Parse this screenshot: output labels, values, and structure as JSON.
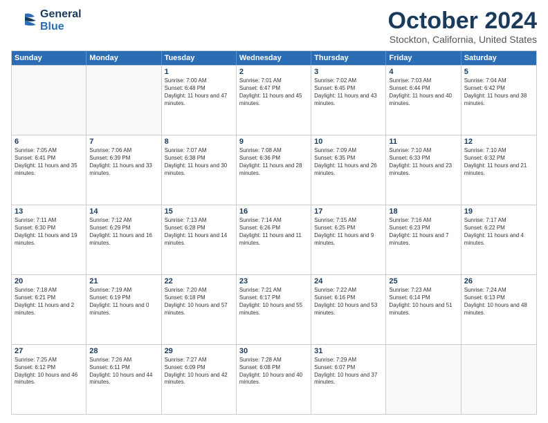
{
  "header": {
    "logo_general": "General",
    "logo_blue": "Blue",
    "title": "October 2024",
    "subtitle": "Stockton, California, United States"
  },
  "days_of_week": [
    "Sunday",
    "Monday",
    "Tuesday",
    "Wednesday",
    "Thursday",
    "Friday",
    "Saturday"
  ],
  "weeks": [
    [
      {
        "day": "",
        "empty": true,
        "content": ""
      },
      {
        "day": "",
        "empty": true,
        "content": ""
      },
      {
        "day": "1",
        "content": "Sunrise: 7:00 AM\nSunset: 6:48 PM\nDaylight: 11 hours and 47 minutes."
      },
      {
        "day": "2",
        "content": "Sunrise: 7:01 AM\nSunset: 6:47 PM\nDaylight: 11 hours and 45 minutes."
      },
      {
        "day": "3",
        "content": "Sunrise: 7:02 AM\nSunset: 6:45 PM\nDaylight: 11 hours and 43 minutes."
      },
      {
        "day": "4",
        "content": "Sunrise: 7:03 AM\nSunset: 6:44 PM\nDaylight: 11 hours and 40 minutes."
      },
      {
        "day": "5",
        "content": "Sunrise: 7:04 AM\nSunset: 6:42 PM\nDaylight: 11 hours and 38 minutes."
      }
    ],
    [
      {
        "day": "6",
        "content": "Sunrise: 7:05 AM\nSunset: 6:41 PM\nDaylight: 11 hours and 35 minutes."
      },
      {
        "day": "7",
        "content": "Sunrise: 7:06 AM\nSunset: 6:39 PM\nDaylight: 11 hours and 33 minutes."
      },
      {
        "day": "8",
        "content": "Sunrise: 7:07 AM\nSunset: 6:38 PM\nDaylight: 11 hours and 30 minutes."
      },
      {
        "day": "9",
        "content": "Sunrise: 7:08 AM\nSunset: 6:36 PM\nDaylight: 11 hours and 28 minutes."
      },
      {
        "day": "10",
        "content": "Sunrise: 7:09 AM\nSunset: 6:35 PM\nDaylight: 11 hours and 26 minutes."
      },
      {
        "day": "11",
        "content": "Sunrise: 7:10 AM\nSunset: 6:33 PM\nDaylight: 11 hours and 23 minutes."
      },
      {
        "day": "12",
        "content": "Sunrise: 7:10 AM\nSunset: 6:32 PM\nDaylight: 11 hours and 21 minutes."
      }
    ],
    [
      {
        "day": "13",
        "content": "Sunrise: 7:11 AM\nSunset: 6:30 PM\nDaylight: 11 hours and 19 minutes."
      },
      {
        "day": "14",
        "content": "Sunrise: 7:12 AM\nSunset: 6:29 PM\nDaylight: 11 hours and 16 minutes."
      },
      {
        "day": "15",
        "content": "Sunrise: 7:13 AM\nSunset: 6:28 PM\nDaylight: 11 hours and 14 minutes."
      },
      {
        "day": "16",
        "content": "Sunrise: 7:14 AM\nSunset: 6:26 PM\nDaylight: 11 hours and 11 minutes."
      },
      {
        "day": "17",
        "content": "Sunrise: 7:15 AM\nSunset: 6:25 PM\nDaylight: 11 hours and 9 minutes."
      },
      {
        "day": "18",
        "content": "Sunrise: 7:16 AM\nSunset: 6:23 PM\nDaylight: 11 hours and 7 minutes."
      },
      {
        "day": "19",
        "content": "Sunrise: 7:17 AM\nSunset: 6:22 PM\nDaylight: 11 hours and 4 minutes."
      }
    ],
    [
      {
        "day": "20",
        "content": "Sunrise: 7:18 AM\nSunset: 6:21 PM\nDaylight: 11 hours and 2 minutes."
      },
      {
        "day": "21",
        "content": "Sunrise: 7:19 AM\nSunset: 6:19 PM\nDaylight: 11 hours and 0 minutes."
      },
      {
        "day": "22",
        "content": "Sunrise: 7:20 AM\nSunset: 6:18 PM\nDaylight: 10 hours and 57 minutes."
      },
      {
        "day": "23",
        "content": "Sunrise: 7:21 AM\nSunset: 6:17 PM\nDaylight: 10 hours and 55 minutes."
      },
      {
        "day": "24",
        "content": "Sunrise: 7:22 AM\nSunset: 6:16 PM\nDaylight: 10 hours and 53 minutes."
      },
      {
        "day": "25",
        "content": "Sunrise: 7:23 AM\nSunset: 6:14 PM\nDaylight: 10 hours and 51 minutes."
      },
      {
        "day": "26",
        "content": "Sunrise: 7:24 AM\nSunset: 6:13 PM\nDaylight: 10 hours and 48 minutes."
      }
    ],
    [
      {
        "day": "27",
        "content": "Sunrise: 7:25 AM\nSunset: 6:12 PM\nDaylight: 10 hours and 46 minutes."
      },
      {
        "day": "28",
        "content": "Sunrise: 7:26 AM\nSunset: 6:11 PM\nDaylight: 10 hours and 44 minutes."
      },
      {
        "day": "29",
        "content": "Sunrise: 7:27 AM\nSunset: 6:09 PM\nDaylight: 10 hours and 42 minutes."
      },
      {
        "day": "30",
        "content": "Sunrise: 7:28 AM\nSunset: 6:08 PM\nDaylight: 10 hours and 40 minutes."
      },
      {
        "day": "31",
        "content": "Sunrise: 7:29 AM\nSunset: 6:07 PM\nDaylight: 10 hours and 37 minutes."
      },
      {
        "day": "",
        "empty": true,
        "content": ""
      },
      {
        "day": "",
        "empty": true,
        "content": ""
      }
    ]
  ]
}
